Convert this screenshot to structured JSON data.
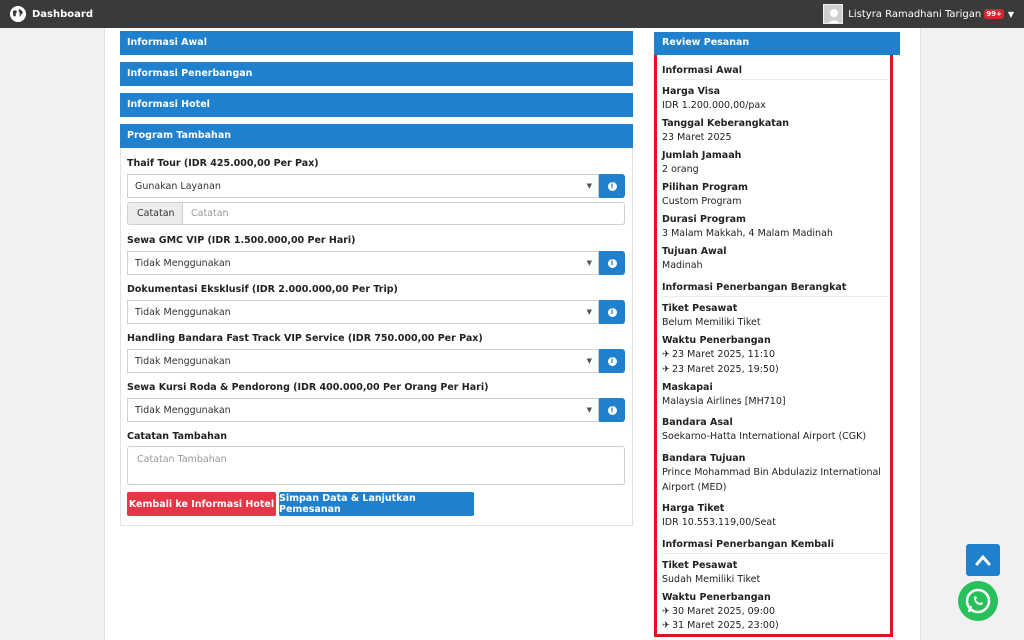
{
  "topbar": {
    "app_title": "Dashboard",
    "user_name": "Listyra Ramadhani Tarigan",
    "notification_badge": "99+"
  },
  "sections": {
    "informasi_awal": "Informasi Awal",
    "informasi_penerbangan": "Informasi Penerbangan",
    "informasi_hotel": "Informasi Hotel",
    "program_tambahan": "Program Tambahan"
  },
  "program": {
    "items": [
      {
        "label": "Thaif Tour (IDR 425.000,00 Per Pax)",
        "selected": "Gunakan Layanan"
      },
      {
        "label": "Sewa GMC VIP (IDR 1.500.000,00 Per Hari)",
        "selected": "Tidak Menggunakan"
      },
      {
        "label": "Dokumentasi Eksklusif (IDR 2.000.000,00 Per Trip)",
        "selected": "Tidak Menggunakan"
      },
      {
        "label": "Handling Bandara Fast Track VIP Service (IDR 750.000,00 Per Pax)",
        "selected": "Tidak Menggunakan"
      },
      {
        "label": "Sewa Kursi Roda & Pendorong (IDR 400.000,00 Per Orang Per Hari)",
        "selected": "Tidak Menggunakan"
      }
    ],
    "catatan_addon": "Catatan",
    "catatan_placeholder": "Catatan",
    "catatan_tambahan_label": "Catatan Tambahan",
    "catatan_tambahan_placeholder": "Catatan Tambahan",
    "back_button": "Kembali ke Informasi Hotel",
    "save_button": "Simpan Data & Lanjutkan Pemesanan"
  },
  "review": {
    "title": "Review Pesanan",
    "section_awal": "Informasi Awal",
    "harga_visa_label": "Harga Visa",
    "harga_visa_value": "IDR 1.200.000,00/pax",
    "tanggal_label": "Tanggal Keberangkatan",
    "tanggal_value": "23 Maret 2025",
    "jamaah_label": "Jumlah Jamaah",
    "jamaah_value": "2 orang",
    "pilihan_label": "Pilihan Program",
    "pilihan_value": "Custom Program",
    "durasi_label": "Durasi Program",
    "durasi_value": "3 Malam Makkah, 4 Malam Madinah",
    "tujuan_label": "Tujuan Awal",
    "tujuan_value": "Madinah",
    "section_berangkat": "Informasi Penerbangan Berangkat",
    "tiket_label": "Tiket Pesawat",
    "tiket_value": "Belum Memiliki Tiket",
    "waktu_label": "Waktu Penerbangan",
    "waktu_depart": "23 Maret 2025, 11:10",
    "waktu_arrive": "23 Maret 2025, 19:50)",
    "maskapai_label": "Maskapai",
    "maskapai_value": "Malaysia Airlines [MH710]",
    "asal_label": "Bandara Asal",
    "asal_value": "Soekarno-Hatta International Airport (CGK)",
    "tujuan_bandara_label": "Bandara Tujuan",
    "tujuan_bandara_value": "Prince Mohammad Bin Abdulaziz International Airport (MED)",
    "harga_tiket_label": "Harga Tiket",
    "harga_tiket_value": "IDR 10.553.119,00/Seat",
    "section_kembali": "Informasi Penerbangan Kembali",
    "tiket_kembali_label": "Tiket Pesawat",
    "tiket_kembali_value": "Sudah Memiliki Tiket",
    "waktu_kembali_label": "Waktu Penerbangan",
    "waktu_kembali_depart": "30 Maret 2025, 09:00",
    "waktu_kembali_arrive": "31 Maret 2025, 23:00)"
  },
  "colors": {
    "primary": "#1f80ce",
    "danger": "#e63646",
    "highlight": "#e0141e",
    "whatsapp": "#27c05a",
    "topbar": "#3a3a3a"
  }
}
